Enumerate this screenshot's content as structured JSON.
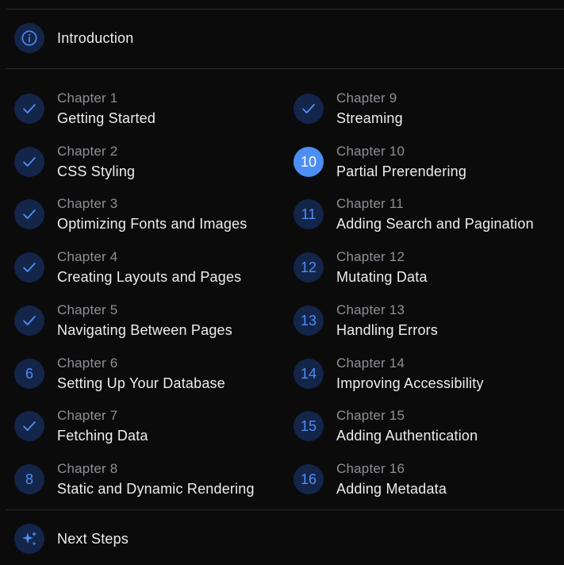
{
  "intro": {
    "label": "Introduction",
    "icon": "info-icon"
  },
  "next": {
    "label": "Next Steps",
    "icon": "sparkles-icon"
  },
  "chapters": [
    {
      "chapter": "Chapter 1",
      "title": "Getting Started",
      "status": "done",
      "number": "1"
    },
    {
      "chapter": "Chapter 2",
      "title": "CSS Styling",
      "status": "done",
      "number": "2"
    },
    {
      "chapter": "Chapter 3",
      "title": "Optimizing Fonts and Images",
      "status": "done",
      "number": "3"
    },
    {
      "chapter": "Chapter 4",
      "title": "Creating Layouts and Pages",
      "status": "done",
      "number": "4"
    },
    {
      "chapter": "Chapter 5",
      "title": "Navigating Between Pages",
      "status": "done",
      "number": "5"
    },
    {
      "chapter": "Chapter 6",
      "title": "Setting Up Your Database",
      "status": "todo",
      "number": "6"
    },
    {
      "chapter": "Chapter 7",
      "title": "Fetching Data",
      "status": "done",
      "number": "7"
    },
    {
      "chapter": "Chapter 8",
      "title": "Static and Dynamic Rendering",
      "status": "todo",
      "number": "8"
    },
    {
      "chapter": "Chapter 9",
      "title": "Streaming",
      "status": "done",
      "number": "9"
    },
    {
      "chapter": "Chapter 10",
      "title": "Partial Prerendering",
      "status": "current",
      "number": "10"
    },
    {
      "chapter": "Chapter 11",
      "title": "Adding Search and Pagination",
      "status": "todo",
      "number": "11"
    },
    {
      "chapter": "Chapter 12",
      "title": "Mutating Data",
      "status": "todo",
      "number": "12"
    },
    {
      "chapter": "Chapter 13",
      "title": "Handling Errors",
      "status": "todo",
      "number": "13"
    },
    {
      "chapter": "Chapter 14",
      "title": "Improving Accessibility",
      "status": "todo",
      "number": "14"
    },
    {
      "chapter": "Chapter 15",
      "title": "Adding Authentication",
      "status": "todo",
      "number": "15"
    },
    {
      "chapter": "Chapter 16",
      "title": "Adding Metadata",
      "status": "todo",
      "number": "16"
    }
  ],
  "colors": {
    "background": "#0b0b0c",
    "badge": "#14254a",
    "accent": "#4d8ef5",
    "muted_text": "#8f8f95",
    "text": "#ededed"
  }
}
